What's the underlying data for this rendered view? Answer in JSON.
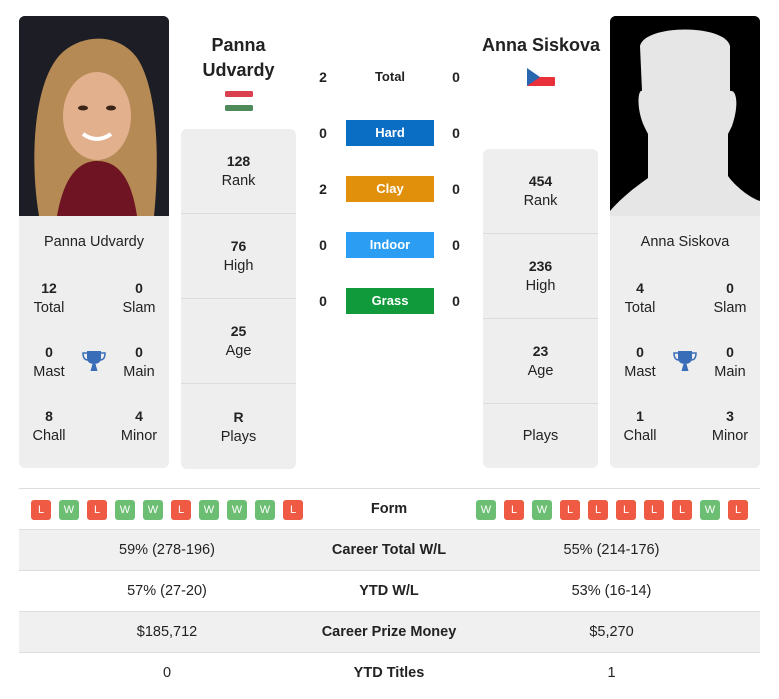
{
  "colors": {
    "hard": "#0a6ec5",
    "clay": "#e0900a",
    "indoor": "#2b9ef4",
    "grass": "#109a3c",
    "win": "#6cbf72",
    "loss": "#ee5a44",
    "trophy": "#3a6db8"
  },
  "player1": {
    "name_line1": "Panna",
    "name_line2": "Udvardy",
    "full_name": "Panna Udvardy",
    "flag": "hungary-flag",
    "stats": [
      {
        "value": "128",
        "label": "Rank"
      },
      {
        "value": "76",
        "label": "High"
      },
      {
        "value": "25",
        "label": "Age"
      },
      {
        "value": "R",
        "label": "Plays"
      }
    ],
    "titles": {
      "total": {
        "value": "12",
        "label": "Total"
      },
      "slam": {
        "value": "0",
        "label": "Slam"
      },
      "mast": {
        "value": "0",
        "label": "Mast"
      },
      "main": {
        "value": "0",
        "label": "Main"
      },
      "chall": {
        "value": "8",
        "label": "Chall"
      },
      "minor": {
        "value": "4",
        "label": "Minor"
      }
    },
    "form": [
      "L",
      "W",
      "L",
      "W",
      "W",
      "L",
      "W",
      "W",
      "W",
      "L"
    ]
  },
  "player2": {
    "full_name": "Anna Siskova",
    "flag": "czech-flag",
    "stats": [
      {
        "value": "454",
        "label": "Rank"
      },
      {
        "value": "236",
        "label": "High"
      },
      {
        "value": "23",
        "label": "Age"
      },
      {
        "value": "",
        "label": "Plays"
      }
    ],
    "titles": {
      "total": {
        "value": "4",
        "label": "Total"
      },
      "slam": {
        "value": "0",
        "label": "Slam"
      },
      "mast": {
        "value": "0",
        "label": "Mast"
      },
      "main": {
        "value": "0",
        "label": "Main"
      },
      "chall": {
        "value": "1",
        "label": "Chall"
      },
      "minor": {
        "value": "3",
        "label": "Minor"
      }
    },
    "form": [
      "W",
      "L",
      "W",
      "L",
      "L",
      "L",
      "L",
      "L",
      "W",
      "L"
    ]
  },
  "h2h": {
    "total": {
      "label": "Total",
      "p1": "2",
      "p2": "0"
    },
    "surfaces": [
      {
        "label": "Hard",
        "p1": "0",
        "p2": "0",
        "color_key": "hard"
      },
      {
        "label": "Clay",
        "p1": "2",
        "p2": "0",
        "color_key": "clay"
      },
      {
        "label": "Indoor",
        "p1": "0",
        "p2": "0",
        "color_key": "indoor"
      },
      {
        "label": "Grass",
        "p1": "0",
        "p2": "0",
        "color_key": "grass"
      }
    ]
  },
  "table": {
    "form_label": "Form",
    "rows": [
      {
        "label": "Career Total W/L",
        "p1": "59% (278-196)",
        "p2": "55% (214-176)"
      },
      {
        "label": "YTD W/L",
        "p1": "57% (27-20)",
        "p2": "53% (16-14)"
      },
      {
        "label": "Career Prize Money",
        "p1": "$185,712",
        "p2": "$5,270"
      },
      {
        "label": "YTD Titles",
        "p1": "0",
        "p2": "1"
      }
    ]
  }
}
